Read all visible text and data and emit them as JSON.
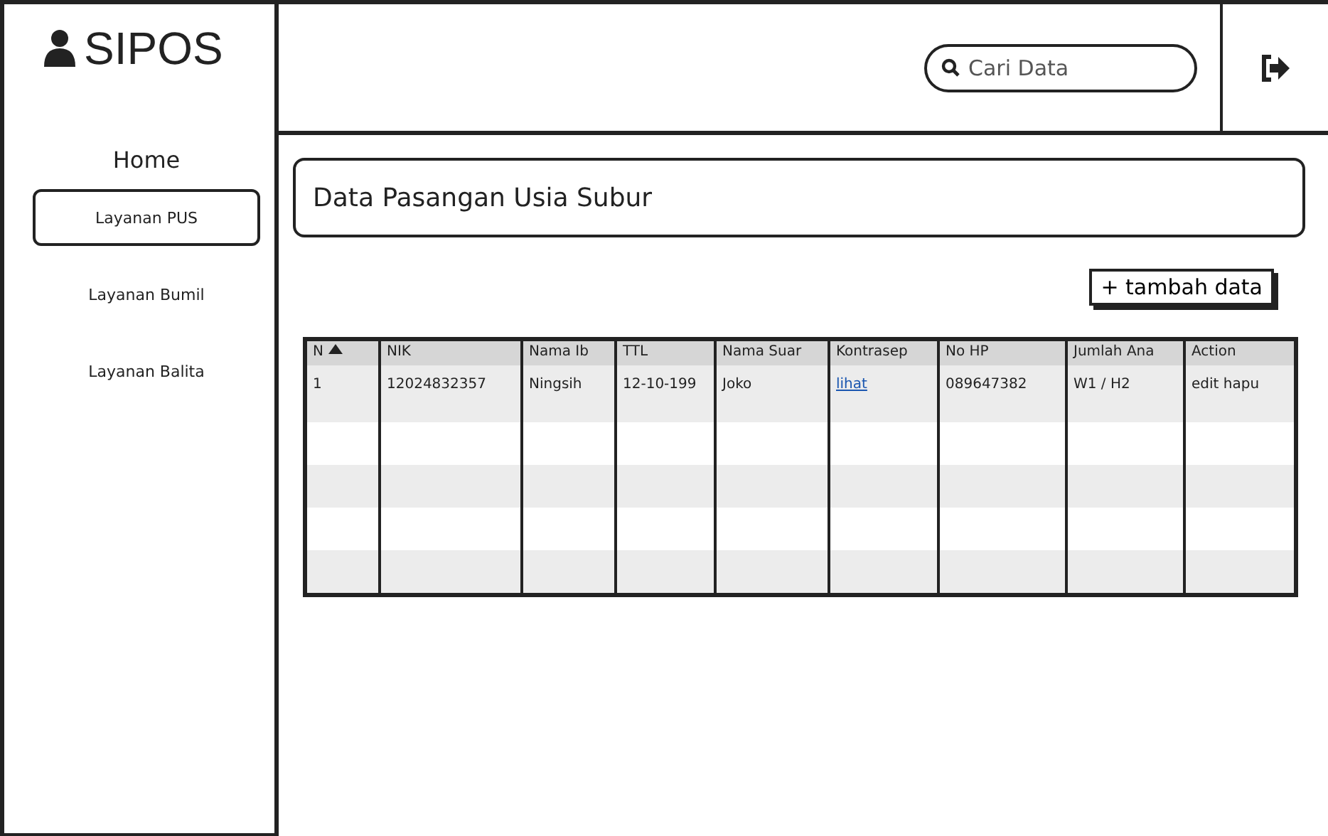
{
  "brand": {
    "name": "SIPOS"
  },
  "sidebar": {
    "items": [
      {
        "label": "Home",
        "selected": false
      },
      {
        "label": "Layanan PUS",
        "selected": true
      },
      {
        "label": "Layanan Bumil",
        "selected": false
      },
      {
        "label": "Layanan Balita",
        "selected": false
      }
    ]
  },
  "search": {
    "placeholder": "Cari Data"
  },
  "page_title": "Data Pasangan Usia Subur",
  "add_button": "+ tambah data",
  "table": {
    "columns": [
      {
        "label": "N",
        "sorted": true
      },
      {
        "label": "NIK",
        "sorted": false
      },
      {
        "label": "Nama Ib",
        "sorted": false
      },
      {
        "label": "TTL",
        "sorted": false
      },
      {
        "label": "Nama Suar",
        "sorted": false
      },
      {
        "label": "Kontrasep",
        "sorted": false
      },
      {
        "label": "No HP",
        "sorted": false
      },
      {
        "label": "Jumlah Ana",
        "sorted": false
      },
      {
        "label": "Action",
        "sorted": false
      }
    ],
    "rows": [
      [
        {
          "text": "1"
        },
        {
          "text": "12024832357"
        },
        {
          "text": "Ningsih"
        },
        {
          "text": "12-10-199"
        },
        {
          "text": "Joko"
        },
        {
          "text": "lihat",
          "kind": "link"
        },
        {
          "text": "089647382"
        },
        {
          "text": "W1 / H2"
        },
        {
          "text": "edit hapu"
        }
      ]
    ]
  }
}
